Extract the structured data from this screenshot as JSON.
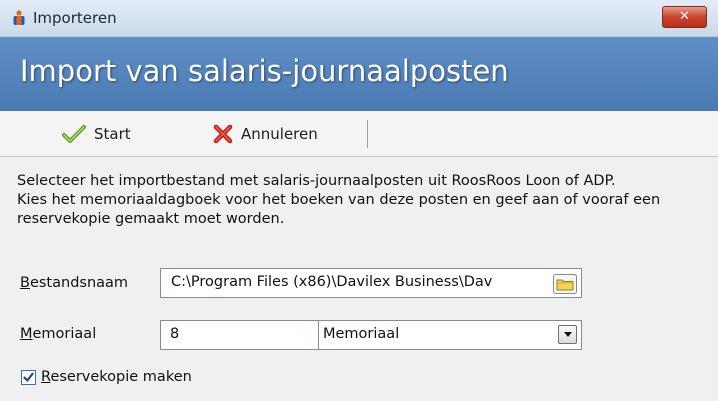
{
  "window": {
    "title": "Importeren",
    "close_label": "✕",
    "app_icon": "app-logo-icon"
  },
  "banner": {
    "title": "Import van salaris-journaalposten"
  },
  "toolbar": {
    "start_label": "Start",
    "start_icon": "checkmark-icon",
    "cancel_label": "Annuleren",
    "cancel_icon": "red-x-icon"
  },
  "description": {
    "line1": "Selecteer het importbestand met salaris-journaalposten uit RoosRoos Loon of ADP.",
    "line2": "Kies het memoriaaldagboek voor het boeken van deze posten en geef aan of vooraf een reservekopie gemaakt moet worden."
  },
  "form": {
    "file_label": "Bestandsnaam",
    "file_label_access": "B",
    "file_label_rest": "estandsnaam",
    "file_value": "C:\\Program Files (x86)\\Davilex Business\\Dav",
    "memo_label": "Memoriaal",
    "memo_label_access": "M",
    "memo_label_rest": "emoriaal",
    "memo_number": "8",
    "memo_selected": "Memoriaal",
    "backup_label_access": "R",
    "backup_label_rest": "eservekopie maken",
    "backup_checked": true
  },
  "colors": {
    "banner": "#5384bc",
    "titlebar": "#d6e2f0",
    "close": "#c9452c"
  }
}
